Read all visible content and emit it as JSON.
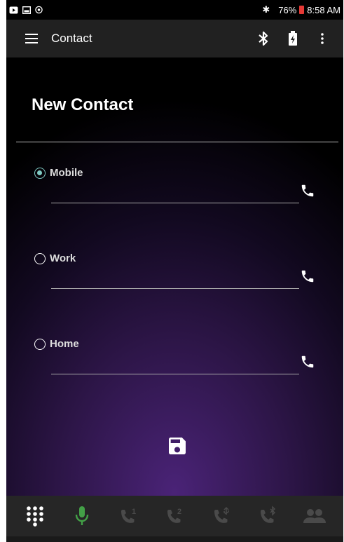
{
  "status_bar": {
    "battery": "76%",
    "time": "8:58 AM",
    "icons": [
      "youtube-icon",
      "gallery-icon",
      "shield-icon",
      "bluetooth-icon",
      "battery-low-icon"
    ]
  },
  "app_bar": {
    "title": "Contact",
    "actions": [
      "bluetooth-icon",
      "battery-icon",
      "more-vert-icon"
    ]
  },
  "form": {
    "heading": "New Contact",
    "selected": "Mobile",
    "fields": [
      {
        "label": "Mobile",
        "value": "",
        "checked": true
      },
      {
        "label": "Work",
        "value": "",
        "checked": false
      },
      {
        "label": "Home",
        "value": "",
        "checked": false
      }
    ]
  },
  "bottom_tabs": [
    {
      "name": "dialpad-icon",
      "active": true
    },
    {
      "name": "microphone-icon",
      "active": true
    },
    {
      "name": "call-line-1-icon",
      "badge": "1"
    },
    {
      "name": "call-line-2-icon",
      "badge": "2"
    },
    {
      "name": "call-usb-icon"
    },
    {
      "name": "call-bluetooth-icon"
    },
    {
      "name": "contacts-icon"
    }
  ],
  "colors": {
    "accent": "#80cbc4",
    "mic": "#43a047",
    "inactive_icon": "#4a4a4a"
  }
}
